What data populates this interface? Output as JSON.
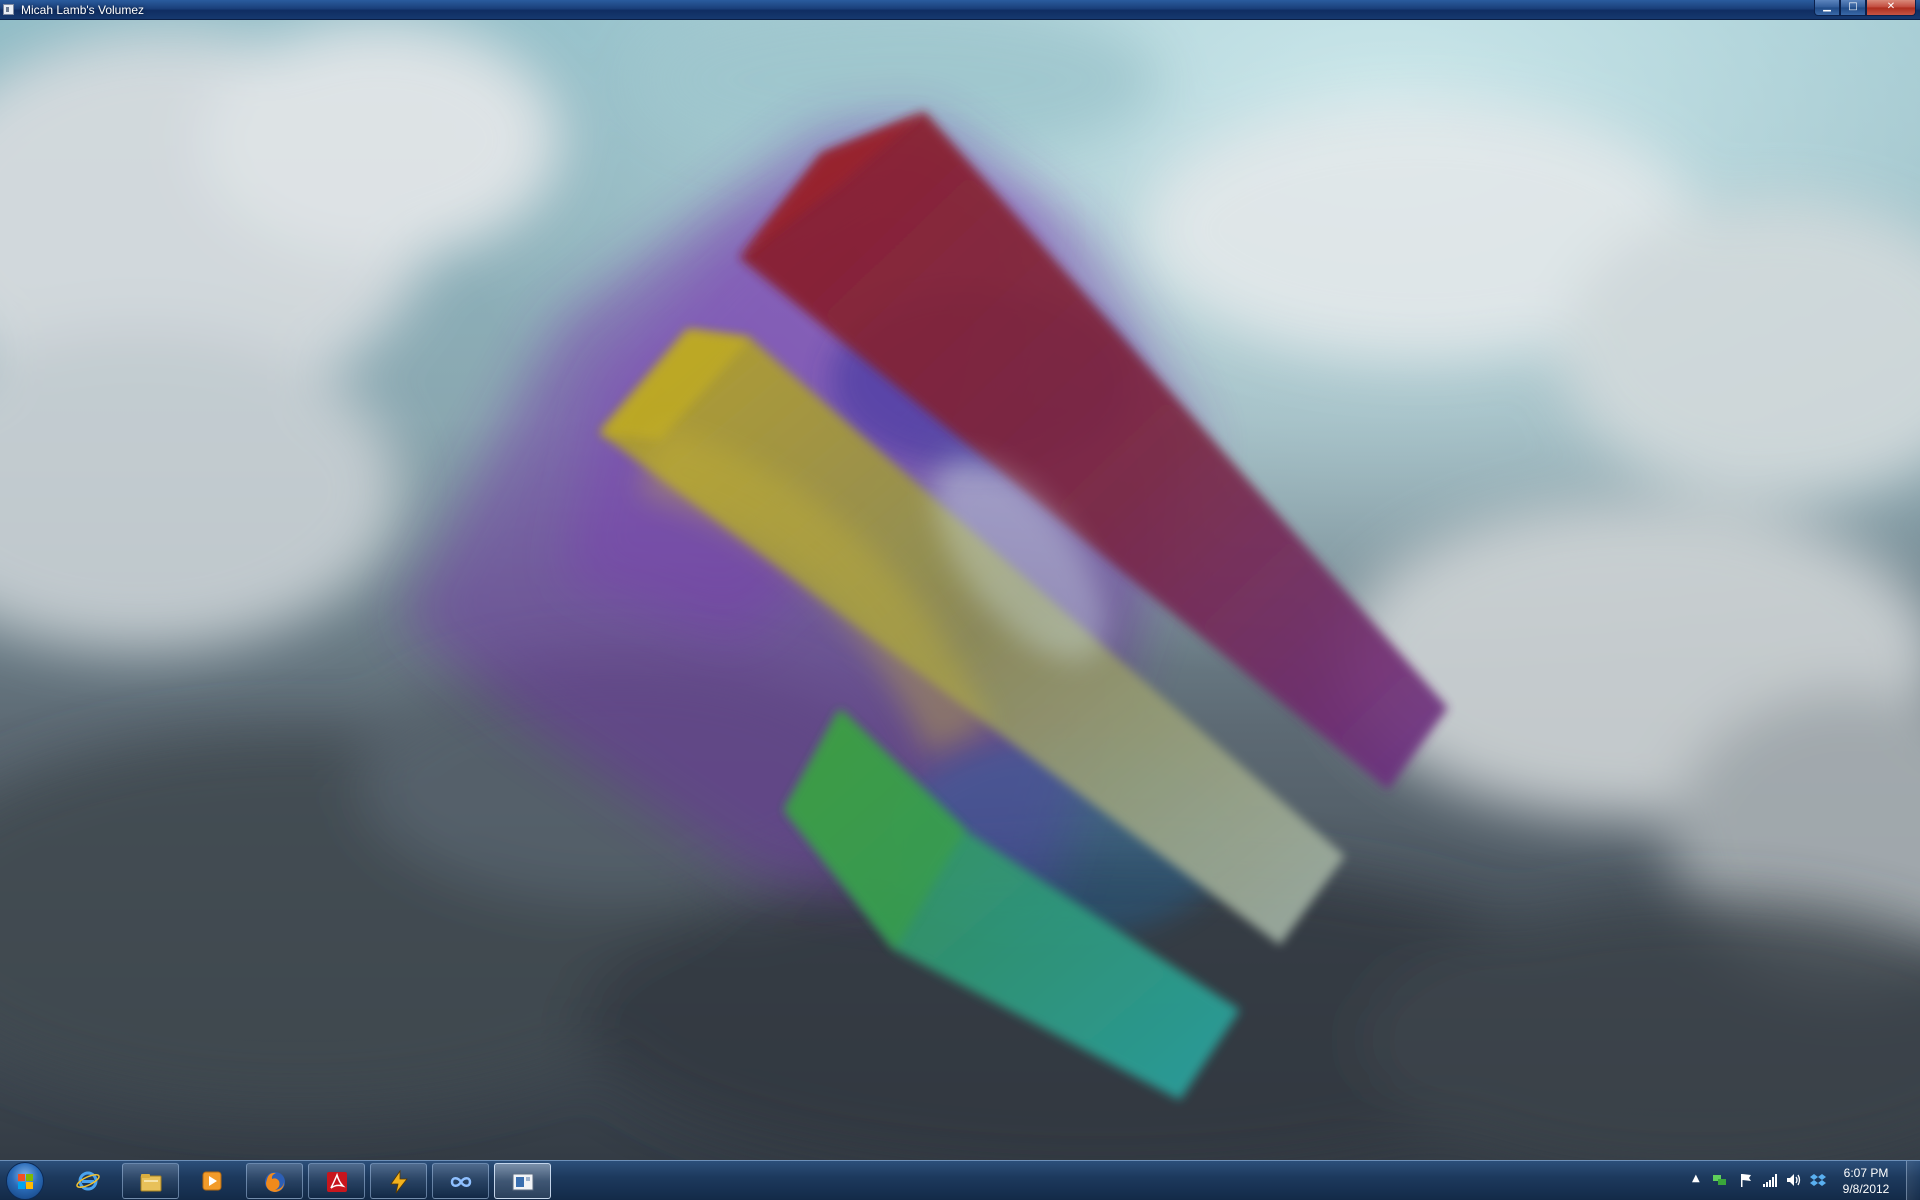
{
  "window": {
    "title": "Micah Lamb's Volumez",
    "icon": "app-window-icon",
    "controls": {
      "minimize_icon": "minimize-icon",
      "maximize_icon": "maximize-icon",
      "close_icon": "close-icon",
      "minimize_glyph": "▁",
      "maximize_glyph": "□",
      "close_glyph": "✕"
    }
  },
  "scene": {
    "background": "cloudy-sky",
    "volumes": [
      {
        "name": "red-bar",
        "color": "#8b2230",
        "accent": "#6a2d8c"
      },
      {
        "name": "yellow-bar",
        "color": "#b5a52a",
        "accent": "#9fb0a6"
      },
      {
        "name": "green-bar",
        "color": "#3a9a3f",
        "accent": "#2aa3a3"
      },
      {
        "name": "purple-haze",
        "color": "#7a2fb0"
      }
    ]
  },
  "taskbar": {
    "start_icon": "windows-start-orb-icon",
    "pinned": [
      {
        "icon": "internet-explorer-icon"
      },
      {
        "icon": "file-explorer-icon"
      },
      {
        "icon": "media-player-icon"
      },
      {
        "icon": "firefox-icon"
      },
      {
        "icon": "adobe-reader-icon"
      },
      {
        "icon": "winamp-icon"
      },
      {
        "icon": "infinity-app-icon"
      },
      {
        "icon": "volumez-app-icon",
        "active": true
      }
    ],
    "tray": {
      "overflow_glyph": "▲",
      "icons": [
        "network-sync-icon",
        "action-center-flag-icon",
        "signal-bars-icon",
        "volume-icon",
        "dropbox-icon"
      ],
      "time": "6:07 PM",
      "date": "9/8/2012"
    },
    "accent": "#1d3a5e"
  }
}
